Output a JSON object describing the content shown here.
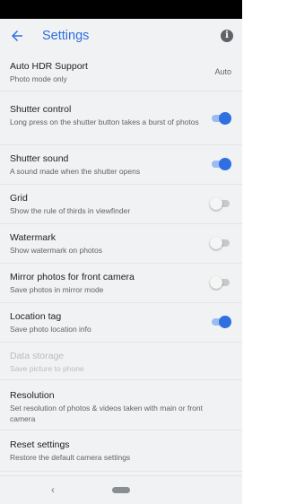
{
  "header": {
    "title": "Settings"
  },
  "settings": [
    {
      "title": "Auto HDR Support",
      "subtitle": "Photo mode only",
      "value": "Auto"
    },
    {
      "title": "Shutter control",
      "subtitle": "Long press on the shutter button takes a burst of photos",
      "toggle": true
    },
    {
      "title": "Shutter sound",
      "subtitle": "A sound made when the shutter opens",
      "toggle": true
    },
    {
      "title": "Grid",
      "subtitle": "Show the rule of thirds in viewfinder",
      "toggle": false
    },
    {
      "title": "Watermark",
      "subtitle": "Show watermark on photos",
      "toggle": false
    },
    {
      "title": "Mirror photos for front camera",
      "subtitle": "Save photos in mirror mode",
      "toggle": false
    },
    {
      "title": "Location tag",
      "subtitle": "Save photo location info",
      "toggle": true
    },
    {
      "title": "Data storage",
      "subtitle": "Save picture to phone",
      "disabled": true
    },
    {
      "title": "Resolution",
      "subtitle": "Set resolution of photos & videos taken with main or front camera"
    },
    {
      "title": "Reset settings",
      "subtitle": "Restore the default camera settings"
    }
  ],
  "colors": {
    "accent": "#2f6fe0",
    "background": "#f1f2f3",
    "status_bar": "#000000"
  },
  "icons": {
    "back": "arrow-left-icon",
    "info": "info-icon",
    "nav_back": "chevron-left-icon",
    "nav_home": "home-pill-icon"
  }
}
